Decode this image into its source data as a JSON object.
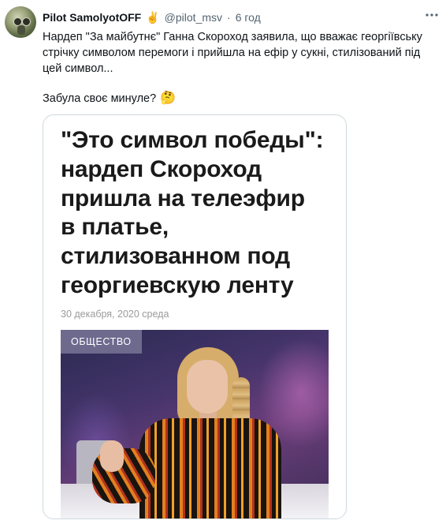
{
  "tweet": {
    "display_name": "Pilot SamolyotOFF",
    "emoji": "✌️",
    "handle": "@pilot_msv",
    "separator": "·",
    "time": "6 год",
    "more_icon": "more-dots-icon",
    "text_lines": [
      "Нардеп \"За майбутнє\" Ганна Скороход заявила, що вважає георгіївську",
      "стрічку символом перемоги і прийшла на ефір у сукні, стилізований під",
      "цей символ..."
    ],
    "text_second": "Забула своє минуле?",
    "emoji_thinking": "🤔"
  },
  "card": {
    "headline_lines": [
      "\"Это символ победы\":",
      "нардеп Скороход",
      "пришла на телеэфир",
      "в платье,",
      "стилизованном под",
      "георгиевскую ленту"
    ],
    "date": "30 декабря, 2020 среда",
    "category_badge": "ОБЩЕСТВО"
  },
  "colors": {
    "text_primary": "#0f1419",
    "text_secondary": "#536471",
    "card_border": "#cfd9de",
    "badge_bg": "#6e6a8e"
  }
}
